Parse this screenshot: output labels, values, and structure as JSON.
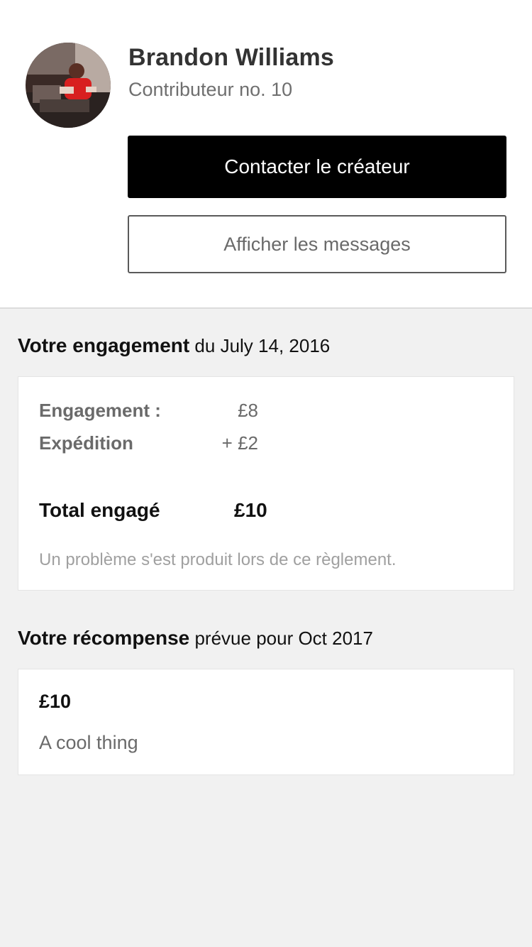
{
  "creator": {
    "name": "Brandon Williams",
    "subtitle": "Contributeur no. 10"
  },
  "actions": {
    "contact_label": "Contacter le créateur",
    "messages_label": "Afficher les messages"
  },
  "pledge": {
    "title_strong": "Votre engagement",
    "title_rest": " du July 14, 2016",
    "rows": [
      {
        "label": "Engagement :",
        "value": "£8"
      },
      {
        "label": "Expédition",
        "value": "+ £2"
      }
    ],
    "total_label": "Total engagé",
    "total_value": "£10",
    "note": "Un problème s'est produit lors de ce règlement."
  },
  "reward": {
    "title_strong": "Votre récompense",
    "title_rest": " prévue pour Oct 2017",
    "amount": "£10",
    "description": "A cool thing"
  },
  "icons": {
    "avatar": "user-avatar-photo"
  },
  "colors": {
    "primary_button": "#000000",
    "page_background": "#f1f1f1",
    "card_background": "#ffffff",
    "muted_text": "#6a6a6a",
    "note_text": "#a0a0a0"
  }
}
